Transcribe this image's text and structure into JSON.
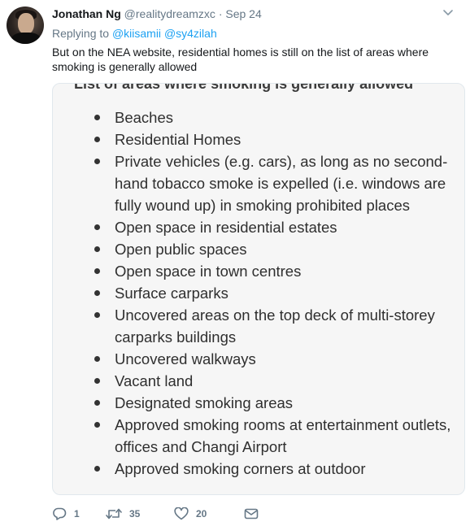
{
  "tweet": {
    "display_name": "Jonathan Ng",
    "handle": "@realitydreamzxc",
    "separator": "·",
    "date": "Sep 24",
    "reply_prefix": "Replying to",
    "reply_handles": [
      "@kiisamii",
      "@sy4zilah"
    ],
    "text": "But on the NEA website, residential homes is still on the list of areas where smoking is generally allowed",
    "icons": {
      "caret": "chevron-down-icon",
      "reply": "reply-icon",
      "retweet": "retweet-icon",
      "like": "heart-icon",
      "dm": "envelope-icon"
    },
    "colors": {
      "link": "#1da1f2",
      "muted": "#657786",
      "text": "#14171a"
    }
  },
  "media": {
    "heading": "List of areas where smoking is generally allowed",
    "items": [
      "Beaches",
      "Residential Homes",
      "Private vehicles (e.g. cars), as long as no second-hand tobacco smoke is expelled (i.e. windows are fully wound up) in smoking prohibited places",
      "Open space in residential estates",
      "Open public spaces",
      "Open space in town centres",
      "Surface carparks",
      "Uncovered areas on the top deck of multi-storey carparks buildings",
      "Uncovered walkways",
      "Vacant land",
      "Designated smoking areas",
      "Approved smoking rooms at entertainment outlets, offices and Changi Airport",
      "Approved smoking corners at outdoor"
    ]
  },
  "actions": {
    "reply_count": "1",
    "retweet_count": "35",
    "like_count": "20"
  }
}
